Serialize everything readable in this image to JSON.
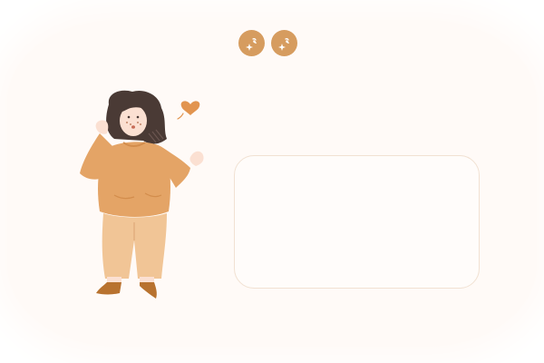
{
  "toolbar": {
    "buttons": [
      {
        "icon": "sparkle-icon"
      },
      {
        "icon": "sparkle-icon"
      }
    ]
  },
  "illustration": {
    "subject": "girl-character"
  },
  "card": {
    "text": ""
  },
  "colors": {
    "accent": "#d69c5f",
    "sweater": "#e4a466",
    "pants": "#f1c596",
    "hair": "#4a3a35",
    "skin": "#fbe0d2",
    "card_border": "#f1e1d2",
    "background": "#fffaf7"
  }
}
